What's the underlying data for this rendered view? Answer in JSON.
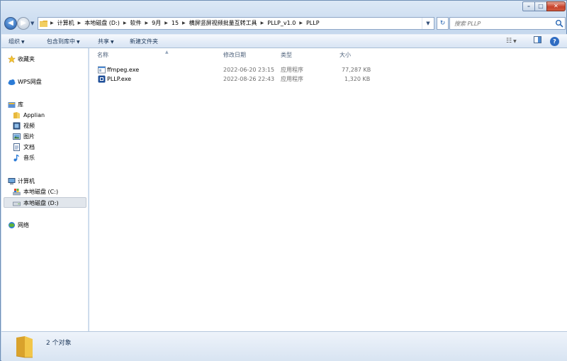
{
  "window": {
    "controls": {
      "minimize": "–",
      "maximize": "□",
      "close": "✕"
    }
  },
  "navigation": {
    "back_glyph": "◀",
    "forward_glyph": "▶",
    "breadcrumbs": [
      "计算机",
      "本地磁盘 (D:)",
      "软件",
      "9月",
      "15",
      "横屏竖屏视频批量互转工具",
      "PLLP_v1.0",
      "PLLP"
    ],
    "refresh_glyph": "↻",
    "search_placeholder": "搜索 PLLP"
  },
  "toolbar": {
    "organize": "组织",
    "include_in_library": "包含到库中",
    "share": "共享",
    "new_folder": "新建文件夹",
    "view_glyph": "☷",
    "help_glyph": "?"
  },
  "sidebar": {
    "favorites": "收藏夹",
    "wps_cloud": "WPS网盘",
    "libraries": "库",
    "library_items": [
      "Applian",
      "视频",
      "图片",
      "文档",
      "音乐"
    ],
    "computer": "计算机",
    "drives": [
      "本地磁盘 (C:)",
      "本地磁盘 (D:)"
    ],
    "network": "网络"
  },
  "file_list": {
    "columns": {
      "name": "名称",
      "modified": "修改日期",
      "type": "类型",
      "size": "大小"
    },
    "rows": [
      {
        "name": "ffmpeg.exe",
        "modified": "2022-06-20 23:15",
        "type": "应用程序",
        "size": "77,287 KB",
        "icon": "ffmpeg-app-icon"
      },
      {
        "name": "PLLP.exe",
        "modified": "2022-08-26 22:43",
        "type": "应用程序",
        "size": "1,320 KB",
        "icon": "pllp-app-icon"
      }
    ]
  },
  "status": {
    "item_count": "2 个对象"
  },
  "colors": {
    "accent": "#1f5aa8",
    "folder": "#e8b83c",
    "selection": "#e1e6ec"
  }
}
